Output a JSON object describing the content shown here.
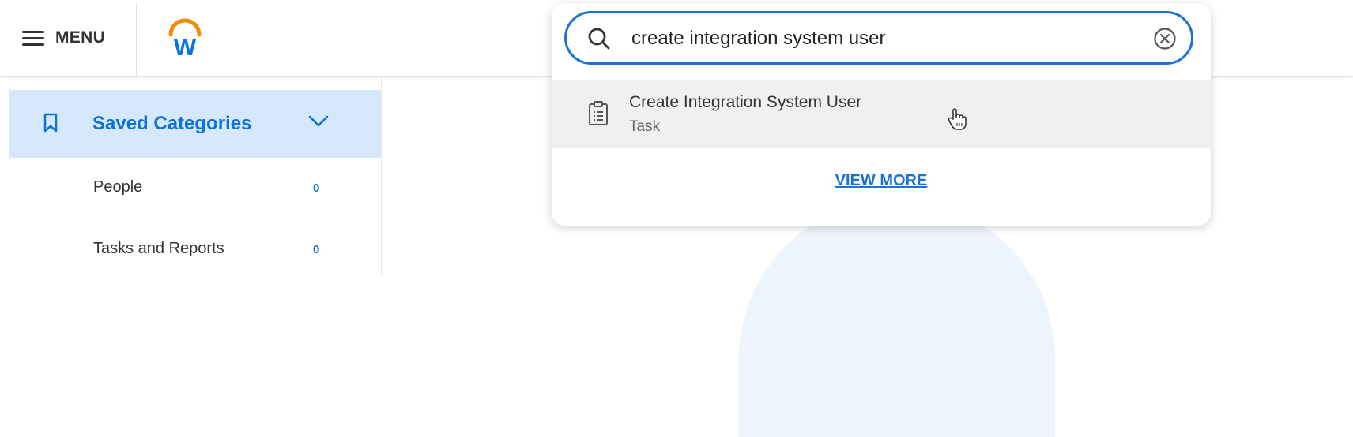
{
  "header": {
    "menu_label": "MENU",
    "logo_letter": "W"
  },
  "sidebar": {
    "saved_categories": {
      "label": "Saved Categories",
      "icon": "bookmark-icon"
    },
    "items": [
      {
        "label": "People",
        "count": "0"
      },
      {
        "label": "Tasks and Reports",
        "count": "0"
      }
    ]
  },
  "search": {
    "value": "create integration system user",
    "results": [
      {
        "title": "Create Integration System User",
        "type": "Task",
        "icon": "clipboard-icon"
      }
    ],
    "view_more_label": "VIEW MORE"
  },
  "colors": {
    "accent": "#1b73d1",
    "sidebar_active_bg": "#d6e8fb",
    "logo_orange": "#f38b00",
    "logo_blue": "#0875e1"
  }
}
